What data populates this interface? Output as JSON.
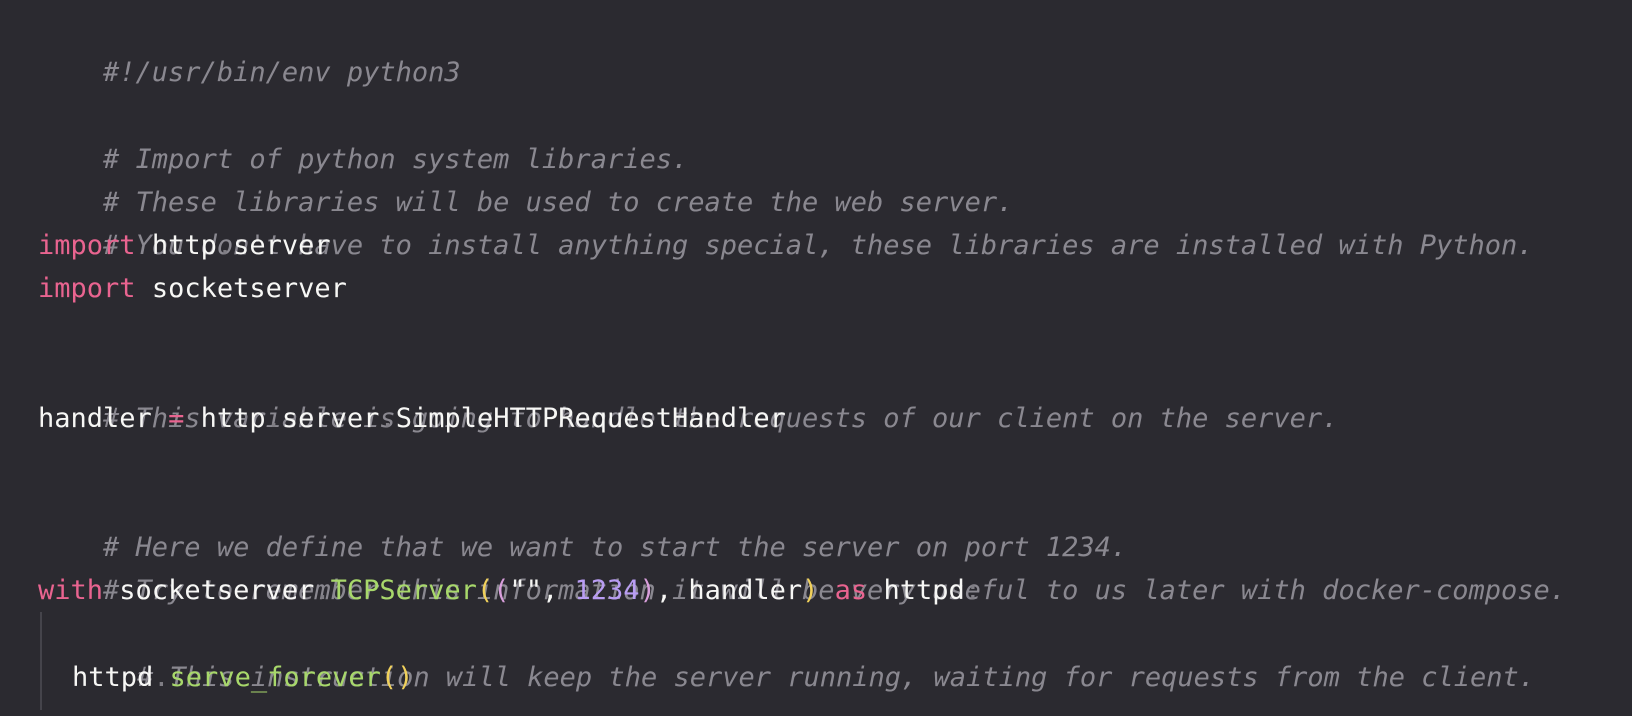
{
  "code": {
    "line1": "#!/usr/bin/env python3",
    "line3": "# Import of python system libraries.",
    "line4": "# These libraries will be used to create the web server.",
    "line5": "# You don't have to install anything special, these libraries are installed with Python.",
    "line6_kw": "import",
    "line6_mod1": "http",
    "line6_dot": ".",
    "line6_mod2": "server",
    "line7_kw": "import",
    "line7_mod": "socketserver",
    "line9": "# This variable is going to handle the requests of our client on the server.",
    "line10_var": "handler",
    "line10_eq": "=",
    "line10_a": "http",
    "line10_dot1": ".",
    "line10_b": "server",
    "line10_dot2": ".",
    "line10_c": "SimpleHTTPRequestHandler",
    "line12": "# Here we define that we want to start the server on port 1234.",
    "line13": "# Try to remember this information it will be very useful to us later with docker-compose.",
    "line14_kw": "with",
    "line14_mod": "socketserver",
    "line14_dot": ".",
    "line14_func": "TCPServer",
    "line14_open1": "(",
    "line14_open2": "(",
    "line14_string": "\"\"",
    "line14_comma1": ", ",
    "line14_num": "1234",
    "line14_close2": ")",
    "line14_comma2": ", ",
    "line14_handler": "handler",
    "line14_close1": ")",
    "line14_as": "as",
    "line14_httpd": "httpd",
    "line14_colon": ":",
    "line15": "# This instruction will keep the server running, waiting for requests from the client.",
    "line16_obj": "httpd",
    "line16_dot": ".",
    "line16_func": "serve_forever",
    "line16_parens": "()"
  },
  "colors": {
    "background": "#2b2a30",
    "comment": "#8a8890",
    "keyword": "#e96490",
    "function": "#a8d86b",
    "number": "#b99df3",
    "paren": "#f1d15b"
  }
}
